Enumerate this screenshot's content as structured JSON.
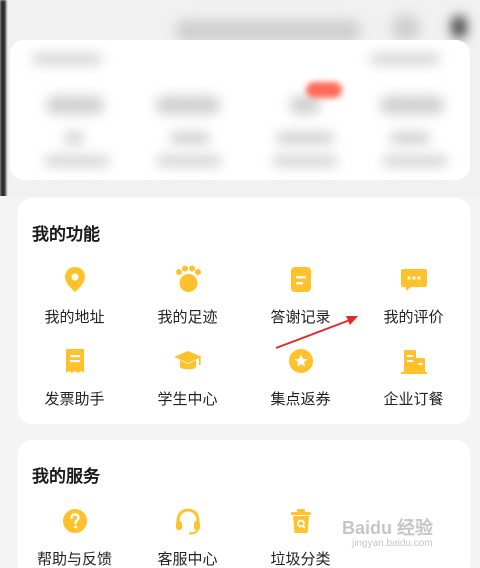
{
  "features": {
    "title": "我的功能",
    "items": [
      {
        "label": "我的地址",
        "icon": "location-pin-icon"
      },
      {
        "label": "我的足迹",
        "icon": "footprint-icon"
      },
      {
        "label": "答谢记录",
        "icon": "document-icon"
      },
      {
        "label": "我的评价",
        "icon": "chat-bubble-icon"
      },
      {
        "label": "发票助手",
        "icon": "invoice-icon"
      },
      {
        "label": "学生中心",
        "icon": "graduation-cap-icon"
      },
      {
        "label": "集点返券",
        "icon": "star-coin-icon"
      },
      {
        "label": "企业订餐",
        "icon": "building-icon"
      }
    ]
  },
  "services": {
    "title": "我的服务",
    "items": [
      {
        "label": "帮助与反馈",
        "icon": "help-icon"
      },
      {
        "label": "客服中心",
        "icon": "headset-icon"
      },
      {
        "label": "垃圾分类",
        "icon": "trash-bin-icon"
      }
    ]
  },
  "watermark": {
    "brand": "Baidu 经验",
    "url": "jingyan.baidu.com"
  },
  "colors": {
    "accent": "#FFC22B",
    "arrow": "#E8262B",
    "card": "#FFFFFF",
    "background": "#F4F4F4"
  }
}
